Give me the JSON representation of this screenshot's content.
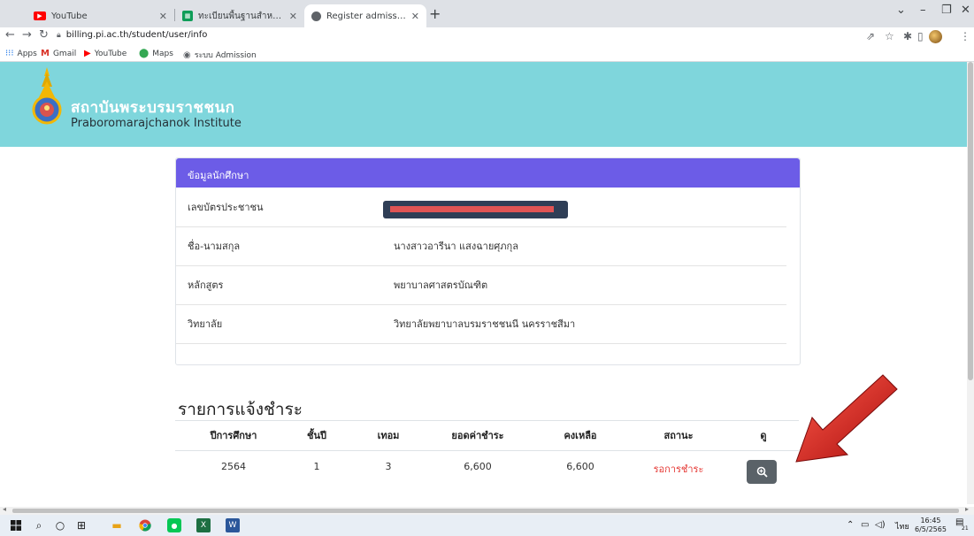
{
  "browser": {
    "tabs": [
      {
        "title": "YouTube",
        "icon": "youtube-icon",
        "color": "#ff0000"
      },
      {
        "title": "ทะเบียนพื้นฐานสำหรับนักเรียน มีผลประก",
        "icon": "sheets-icon",
        "color": "#0f9d58"
      },
      {
        "title": "Register admission Payment",
        "icon": "globe-icon",
        "color": "#5f6368"
      }
    ],
    "new_tab": "+",
    "url": "billing.pi.ac.th/student/user/info",
    "bookmarks": [
      {
        "label": "Apps",
        "icon": "apps-grid-icon"
      },
      {
        "label": "Gmail",
        "icon": "gmail-icon"
      },
      {
        "label": "YouTube",
        "icon": "youtube-icon"
      },
      {
        "label": "Maps",
        "icon": "maps-pin-icon"
      },
      {
        "label": "ระบบ Admission",
        "icon": "globe-icon"
      }
    ]
  },
  "site": {
    "name_th": "สถาบันพระบรมราชชนก",
    "name_en": "Praboromarajchanok Institute"
  },
  "student_card": {
    "title": "ข้อมูลนักศึกษา",
    "rows": [
      {
        "label": "เลขบัตรประชาชน",
        "value": ""
      },
      {
        "label": "ชื่อ-นามสกุล",
        "value": "นางสาวอารีนา แสงฉายศุภกุล"
      },
      {
        "label": "หลักสูตร",
        "value": "พยาบาลศาสตรบัณฑิต"
      },
      {
        "label": "วิทยาลัย",
        "value": "วิทยาลัยพยาบาลบรมราชชนนี นครราชสีมา"
      }
    ]
  },
  "payments": {
    "title": "รายการแจ้งชำระ",
    "headers": [
      "ปีการศึกษา",
      "ชั้นปี",
      "เทอม",
      "ยอดค่าชำระ",
      "คงเหลือ",
      "สถานะ",
      "ดู"
    ],
    "rows": [
      {
        "year": "2564",
        "level": "1",
        "term": "3",
        "amount": "6,600",
        "balance": "6,600",
        "status": "รอการชำระ",
        "view_icon": "zoom-in-icon"
      }
    ]
  },
  "taskbar": {
    "lang": "ไทย",
    "time": "16:45",
    "date": "6/5/2565",
    "notifications": "21"
  },
  "colors": {
    "header_bg": "#7fd6dc",
    "card_head_bg": "#6c5ce7",
    "status_pending": "#e53935",
    "view_button": "#5a6268"
  }
}
